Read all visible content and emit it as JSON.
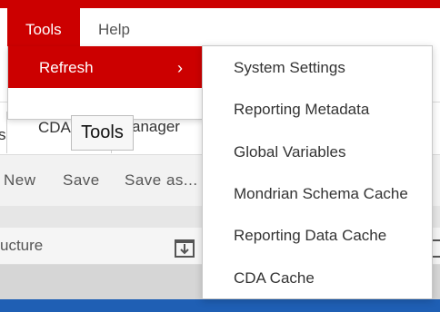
{
  "menubar": {
    "tools": "Tools",
    "help": "Help"
  },
  "tools_menu": {
    "refresh": "Refresh",
    "chevron": "›"
  },
  "submenu": {
    "items": [
      "System Settings",
      "Reporting Metadata",
      "Global Variables",
      "Mondrian Schema Cache",
      "Reporting Data Cache",
      "CDA Cache"
    ]
  },
  "tabs": {
    "left_fragment": "s",
    "cda": "CDA",
    "manager_fragment": "anager"
  },
  "tooltip": {
    "text": "Tools"
  },
  "toolbar": {
    "new": "New",
    "save": "Save",
    "save_as": "Save as..."
  },
  "panel": {
    "structure_label": "ucture"
  },
  "colors": {
    "accent": "#cc0000",
    "bottom_bar": "#1f5fb4"
  }
}
